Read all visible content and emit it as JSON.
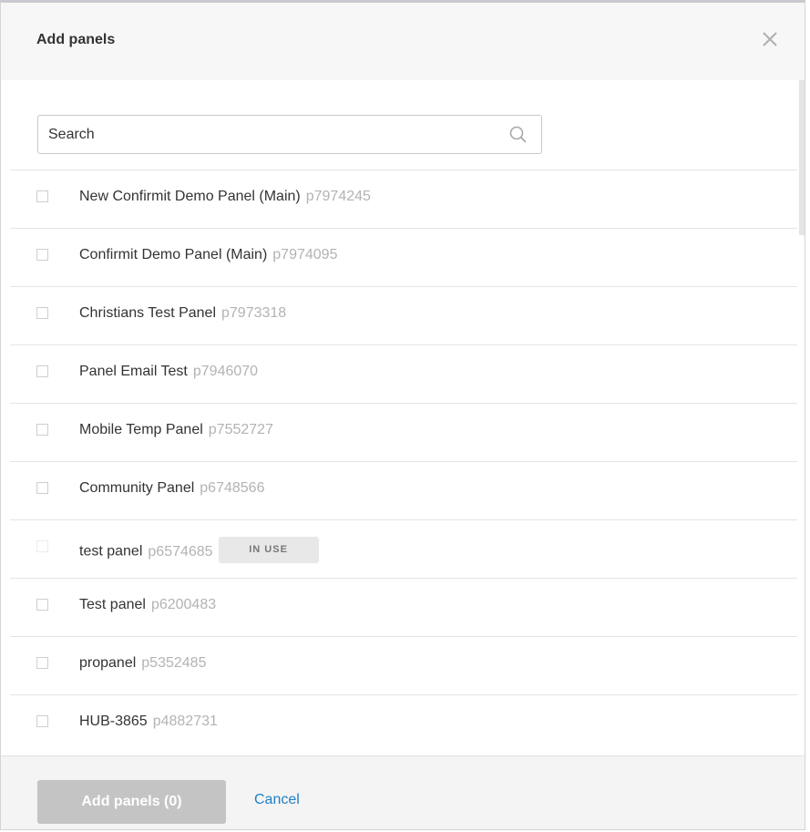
{
  "dialog": {
    "title": "Add panels",
    "close_icon": "close-icon"
  },
  "search": {
    "placeholder": "Search",
    "value": "",
    "icon": "search-icon"
  },
  "panels": [
    {
      "name": "New Confirmit Demo Panel (Main)",
      "id": "p7974245",
      "badge": "",
      "disabled": false
    },
    {
      "name": "Confirmit Demo Panel (Main)",
      "id": "p7974095",
      "badge": "",
      "disabled": false
    },
    {
      "name": "Christians Test Panel",
      "id": "p7973318",
      "badge": "",
      "disabled": false
    },
    {
      "name": "Panel Email Test",
      "id": "p7946070",
      "badge": "",
      "disabled": false
    },
    {
      "name": "Mobile Temp Panel",
      "id": "p7552727",
      "badge": "",
      "disabled": false
    },
    {
      "name": "Community Panel",
      "id": "p6748566",
      "badge": "",
      "disabled": false
    },
    {
      "name": "test panel",
      "id": "p6574685",
      "badge": "IN USE",
      "disabled": true
    },
    {
      "name": "Test panel",
      "id": "p6200483",
      "badge": "",
      "disabled": false
    },
    {
      "name": "propanel",
      "id": "p5352485",
      "badge": "",
      "disabled": false
    },
    {
      "name": "HUB-3865",
      "id": "p4882731",
      "badge": "",
      "disabled": false
    }
  ],
  "footer": {
    "add_label": "Add panels (0)",
    "cancel_label": "Cancel"
  },
  "colors": {
    "accent": "#1f7fc6",
    "button_disabled": "#c4c4c4",
    "header_bg": "#f7f7f7"
  }
}
